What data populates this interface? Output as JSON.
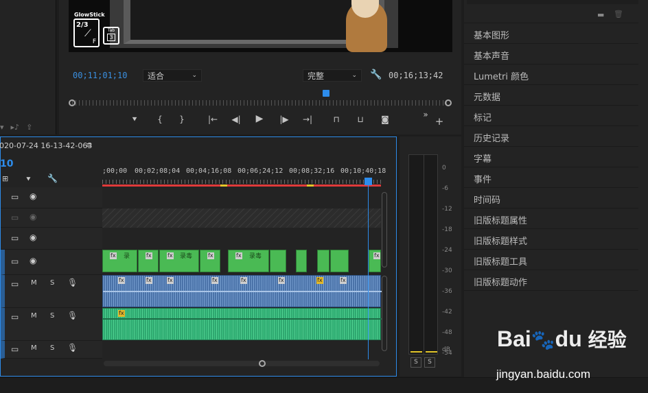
{
  "monitor": {
    "current_time": "00;11;01;10",
    "fit_label": "适合",
    "quality_label": "完整",
    "duration": "00;16;13;42",
    "overlay_title": "GlowStick",
    "overlay_fraction": "2/3",
    "overlay_letter": "F",
    "overlay_tab": "Tab",
    "overlay_key": "3"
  },
  "right_panel": {
    "items": [
      "基本图形",
      "基本声音",
      "Lumetri 颜色",
      "元数据",
      "标记",
      "历史记录",
      "字幕",
      "事件",
      "时间码",
      "旧版标题属性",
      "旧版标题样式",
      "旧版标题工具",
      "旧版标题动作"
    ]
  },
  "timeline": {
    "sequence_name": "020-07-24 16-13-42-063",
    "timecode": "10",
    "ruler": [
      ";00;00",
      "00;02;08;04",
      "00;04;16;08",
      "00;06;24;12",
      "00;08;32;16",
      "00;10;40;18"
    ],
    "track_m": "M",
    "track_s": "S",
    "clip_text": "录",
    "clip_text2": "录毒"
  },
  "meter": {
    "scale": [
      "0",
      "-6",
      "-12",
      "-18",
      "-24",
      "-30",
      "-36",
      "-42",
      "-48",
      "-54",
      "dB"
    ],
    "solo_left": "S",
    "solo_right": "S"
  },
  "watermark": {
    "brand": "Bai",
    "brand2": "du",
    "cn": "经验",
    "url": "jingyan.baidu.com"
  },
  "colors": {
    "accent": "#2d8ceb",
    "clip_video": "#4aba54",
    "clip_audio": "#4a72a8",
    "clip_audio2": "#2fa870"
  }
}
